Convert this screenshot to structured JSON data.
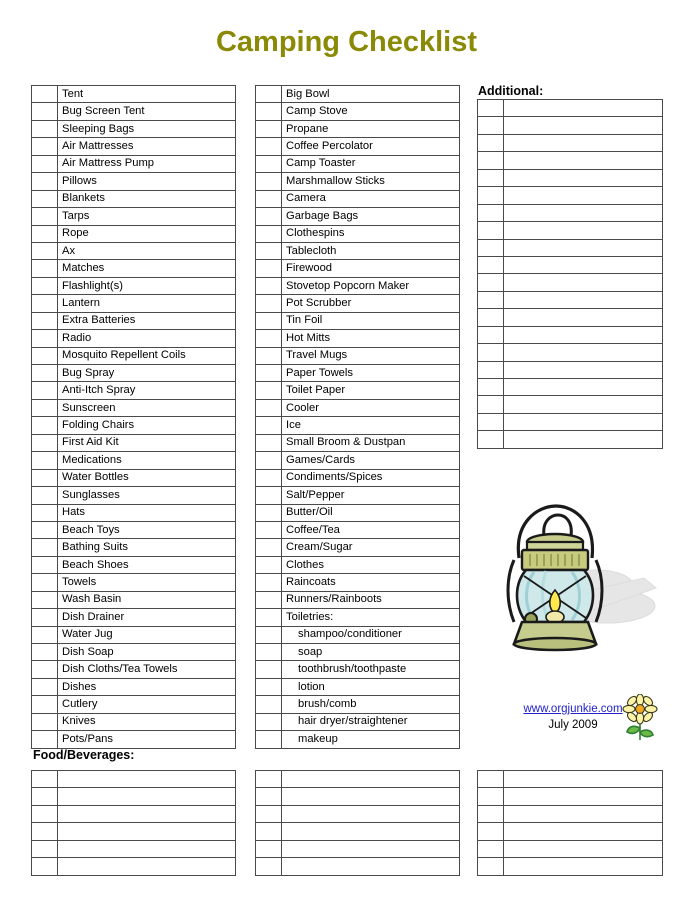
{
  "document": {
    "title": "Camping Checklist",
    "title_color": "#8a8a06"
  },
  "columns": {
    "gear_column": {
      "items": [
        "Tent",
        "Bug Screen Tent",
        "Sleeping Bags",
        "Air Mattresses",
        "Air Mattress Pump",
        "Pillows",
        "Blankets",
        "Tarps",
        "Rope",
        "Ax",
        "Matches",
        "Flashlight(s)",
        "Lantern",
        "Extra Batteries",
        "Radio",
        "Mosquito Repellent Coils",
        "Bug Spray",
        "Anti-Itch Spray",
        "Sunscreen",
        "Folding Chairs",
        "First Aid Kit",
        "Medications",
        "Water Bottles",
        "Sunglasses",
        "Hats",
        "Beach Toys",
        "Bathing Suits",
        "Beach Shoes",
        "Towels",
        "Wash Basin",
        "Dish Drainer",
        "Water Jug",
        "Dish Soap",
        "Dish Cloths/Tea Towels",
        "Dishes",
        "Cutlery",
        "Knives",
        "Pots/Pans"
      ]
    },
    "kitchen_column": {
      "items": [
        {
          "label": "Big Bowl",
          "indent": false
        },
        {
          "label": "Camp Stove",
          "indent": false
        },
        {
          "label": "Propane",
          "indent": false
        },
        {
          "label": "Coffee Percolator",
          "indent": false
        },
        {
          "label": "Camp Toaster",
          "indent": false
        },
        {
          "label": "Marshmallow Sticks",
          "indent": false
        },
        {
          "label": "Camera",
          "indent": false
        },
        {
          "label": "Garbage Bags",
          "indent": false
        },
        {
          "label": "Clothespins",
          "indent": false
        },
        {
          "label": "Tablecloth",
          "indent": false
        },
        {
          "label": "Firewood",
          "indent": false
        },
        {
          "label": "Stovetop Popcorn Maker",
          "indent": false
        },
        {
          "label": "Pot Scrubber",
          "indent": false
        },
        {
          "label": "Tin Foil",
          "indent": false
        },
        {
          "label": "Hot Mitts",
          "indent": false
        },
        {
          "label": "Travel Mugs",
          "indent": false
        },
        {
          "label": "Paper Towels",
          "indent": false
        },
        {
          "label": "Toilet Paper",
          "indent": false
        },
        {
          "label": "Cooler",
          "indent": false
        },
        {
          "label": "Ice",
          "indent": false
        },
        {
          "label": "Small Broom & Dustpan",
          "indent": false
        },
        {
          "label": "Games/Cards",
          "indent": false
        },
        {
          "label": "Condiments/Spices",
          "indent": false
        },
        {
          "label": "Salt/Pepper",
          "indent": false
        },
        {
          "label": "Butter/Oil",
          "indent": false
        },
        {
          "label": "Coffee/Tea",
          "indent": false
        },
        {
          "label": "Cream/Sugar",
          "indent": false
        },
        {
          "label": "Clothes",
          "indent": false
        },
        {
          "label": "Raincoats",
          "indent": false
        },
        {
          "label": "Runners/Rainboots",
          "indent": false
        },
        {
          "label": "Toiletries:",
          "indent": false
        },
        {
          "label": "shampoo/conditioner",
          "indent": true
        },
        {
          "label": "soap",
          "indent": true
        },
        {
          "label": "toothbrush/toothpaste",
          "indent": true
        },
        {
          "label": "lotion",
          "indent": true
        },
        {
          "label": "brush/comb",
          "indent": true
        },
        {
          "label": "hair dryer/straightener",
          "indent": true
        },
        {
          "label": "makeup",
          "indent": true
        }
      ]
    }
  },
  "additional": {
    "heading": "Additional:",
    "blank_rows": 20
  },
  "food": {
    "heading": "Food/Beverages:",
    "tables": [
      {
        "blank_rows": 6
      },
      {
        "blank_rows": 6
      },
      {
        "blank_rows": 6
      }
    ]
  },
  "footer": {
    "link_text": "www.orgjunkie.com",
    "link_color": "#2222cc",
    "date": "July 2009"
  },
  "artwork": {
    "lantern": "camping-lantern-illustration",
    "flower": "daisy-flower-illustration"
  }
}
